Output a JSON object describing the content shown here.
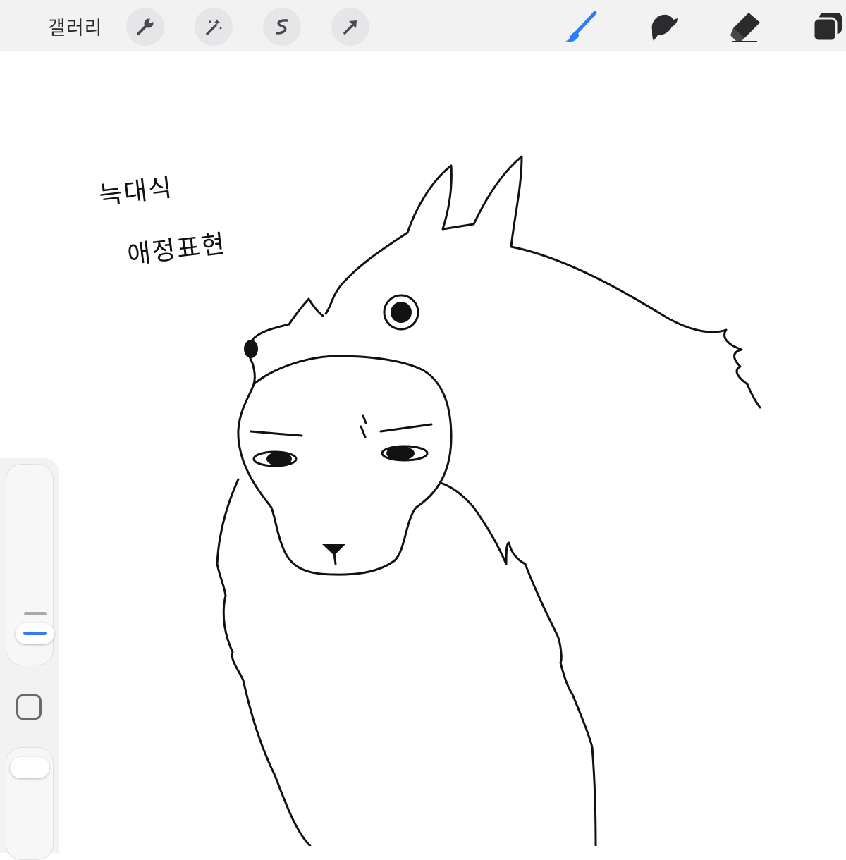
{
  "toolbar": {
    "gallery_label": "갤러리",
    "left_tools": [
      "wrench-icon",
      "magic-wand-icon",
      "selection-icon",
      "transform-arrow-icon"
    ],
    "right_tools": [
      "brush-icon",
      "smudge-icon",
      "eraser-icon",
      "layers-icon"
    ],
    "active_tool": "brush-icon",
    "accent_color": "#2f7cf6"
  },
  "canvas": {
    "note_line1": "늑대식",
    "note_line2": "애정표현",
    "drawing": "wolf-hood-sketch"
  },
  "sidebar": {
    "controls": [
      "brush-size-slider",
      "modify-button",
      "opacity-slider"
    ]
  }
}
